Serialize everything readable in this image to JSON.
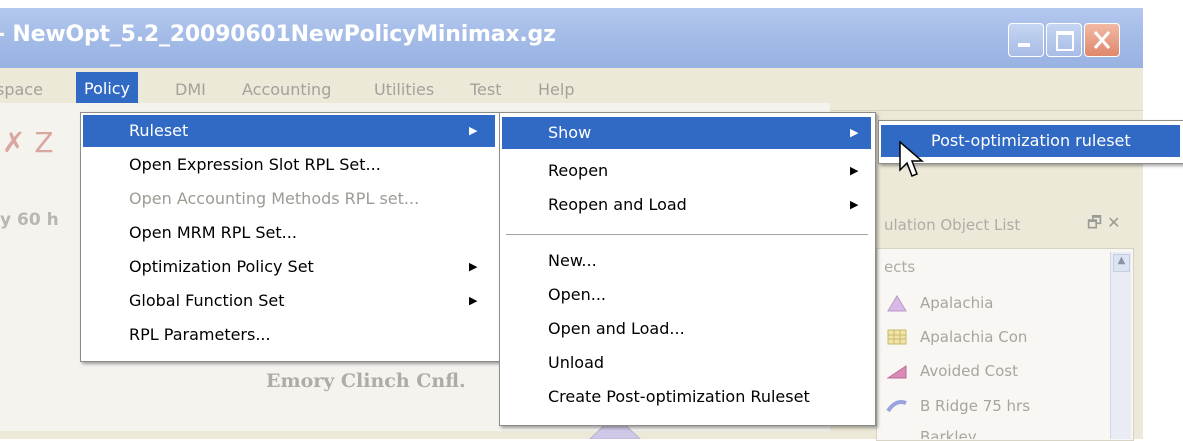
{
  "window": {
    "title": "- NewOpt_5.2_20090601NewPolicyMinimax.gz"
  },
  "menubar": {
    "items": [
      "space",
      "Policy",
      "DMI",
      "Accounting",
      "Utilities",
      "Test",
      "Help"
    ],
    "active": "Policy"
  },
  "background": {
    "partial_label": "y 60 h",
    "node_label": "Emory Clinch Cnfl.",
    "pane_title": "ulation Object List",
    "objects_header": "ects",
    "objects": [
      "Apalachia",
      "Apalachia Con",
      "Avoided Cost",
      "B Ridge 75 hrs",
      "Barkley"
    ]
  },
  "policy_menu": {
    "items": [
      {
        "label": "Ruleset",
        "submenu": true,
        "highlighted": true,
        "enabled": true
      },
      {
        "label": "Open Expression Slot RPL Set...",
        "submenu": false,
        "enabled": true
      },
      {
        "label": "Open Accounting Methods RPL set...",
        "submenu": false,
        "enabled": false
      },
      {
        "label": "Open MRM RPL Set...",
        "submenu": false,
        "enabled": true
      },
      {
        "label": "Optimization Policy Set",
        "submenu": true,
        "enabled": true
      },
      {
        "label": "Global Function Set",
        "submenu": true,
        "enabled": true
      },
      {
        "label": "RPL Parameters...",
        "submenu": false,
        "enabled": true
      }
    ]
  },
  "ruleset_menu": {
    "items": [
      {
        "label": "Show",
        "submenu": true,
        "highlighted": true
      },
      {
        "label": "Reopen",
        "submenu": true
      },
      {
        "label": "Reopen and Load",
        "submenu": true
      },
      {
        "label": "New..."
      },
      {
        "label": "Open..."
      },
      {
        "label": "Open and Load..."
      },
      {
        "label": "Unload"
      },
      {
        "label": "Create Post-optimization Ruleset"
      }
    ]
  },
  "show_menu": {
    "items": [
      {
        "label": "Post-optimization ruleset",
        "highlighted": true
      }
    ]
  },
  "colors": {
    "highlight": "#316ac5",
    "menu_bg": "#ffffff",
    "menubar_bg": "#ece9d8",
    "disabled_text": "#9d9b94"
  }
}
